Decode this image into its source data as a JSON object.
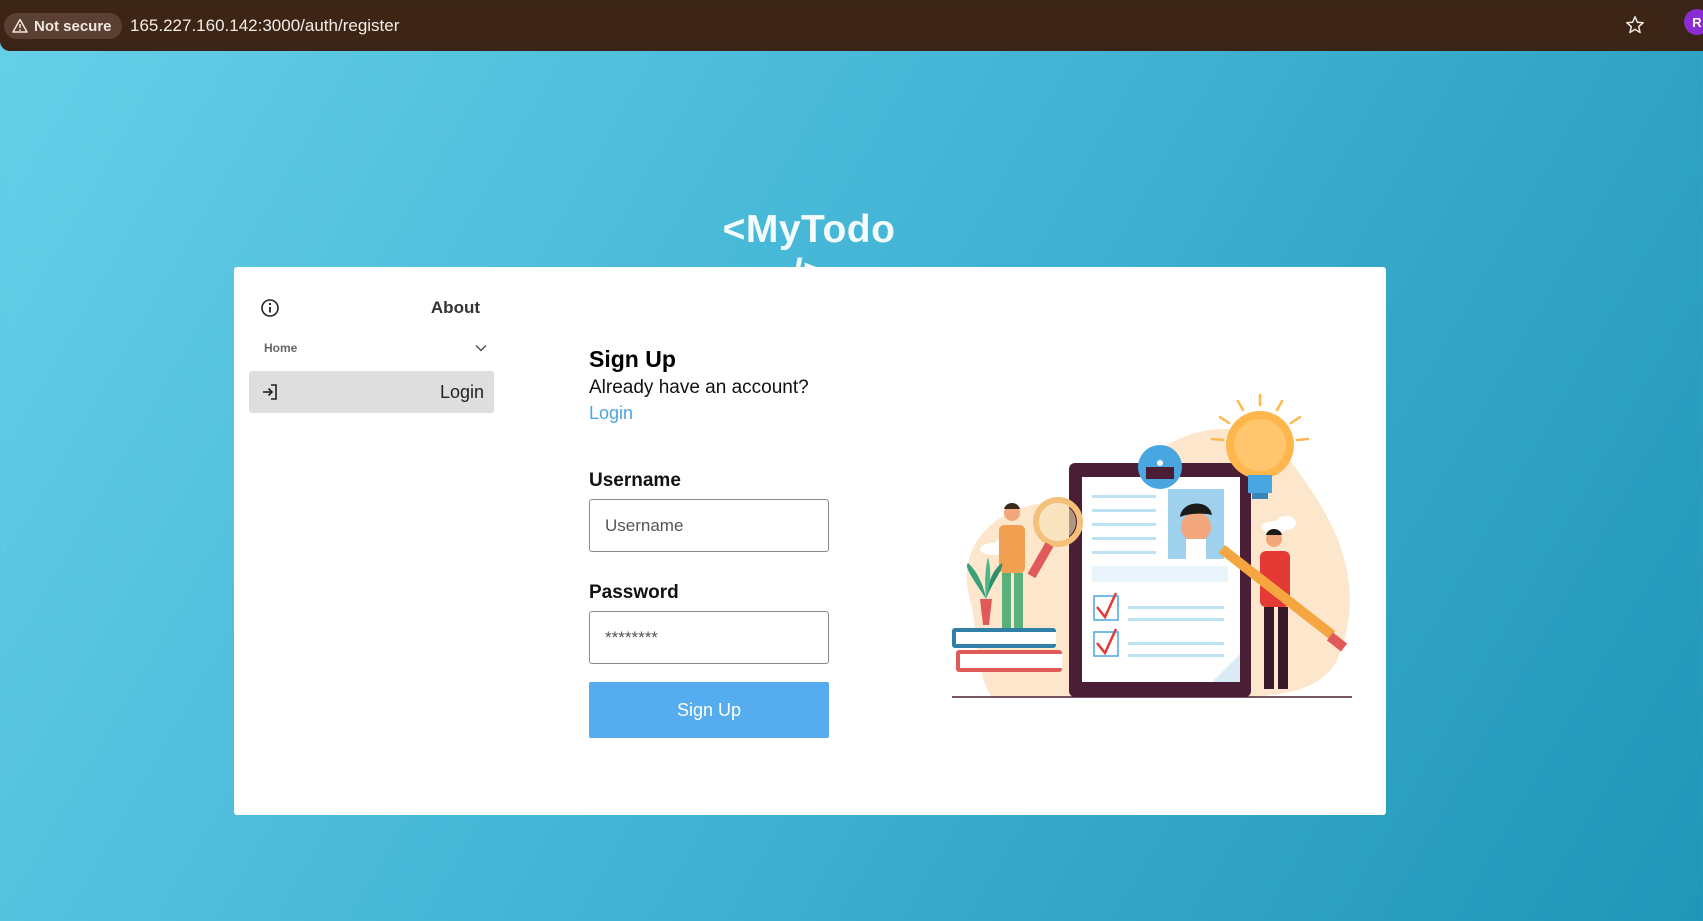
{
  "browser": {
    "security_label": "Not secure",
    "url": "165.227.160.142:3000/auth/register",
    "profile_initial": "R"
  },
  "app": {
    "logo": "<MyTodo />"
  },
  "sidebar": {
    "about_label": "About",
    "home_label": "Home",
    "login_label": "Login"
  },
  "form": {
    "title": "Sign Up",
    "already_text": "Already have an account?",
    "login_link": "Login",
    "username_label": "Username",
    "username_placeholder": "Username",
    "password_label": "Password",
    "password_placeholder": "********",
    "submit_label": "Sign Up"
  },
  "colors": {
    "primary_button": "#55adef",
    "link": "#4aa6e0",
    "active_nav_bg": "#dedede"
  }
}
